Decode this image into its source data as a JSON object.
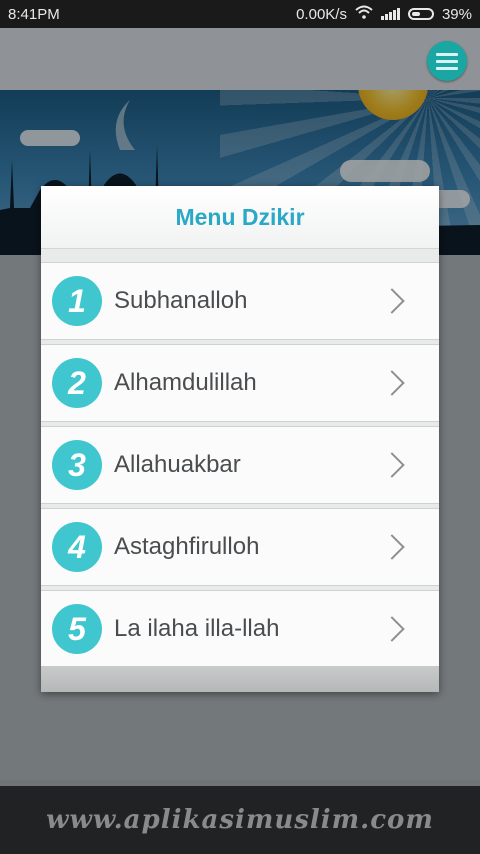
{
  "status_bar": {
    "time": "8:41PM",
    "network_speed": "0.00K/s",
    "battery": "39%",
    "icons": [
      "wifi-icon",
      "signal-icon",
      "battery-icon"
    ]
  },
  "toolbar": {
    "menu_icon": "hamburger-menu-icon",
    "accent": "#1aa6a2"
  },
  "dialog": {
    "title": "Menu Dzikir",
    "title_color": "#2aa9c7",
    "items": [
      {
        "number": "1",
        "label": "Subhanalloh"
      },
      {
        "number": "2",
        "label": "Alhamdulillah"
      },
      {
        "number": "3",
        "label": "Allahuakbar"
      },
      {
        "number": "4",
        "label": "Astaghfirulloh"
      },
      {
        "number": "5",
        "label": "La ilaha illa-llah"
      }
    ],
    "badge_color": "#3fc6cf",
    "chevron_icon": "chevron-right-icon"
  },
  "footer": {
    "website": "www.aplikasimuslim.com"
  }
}
